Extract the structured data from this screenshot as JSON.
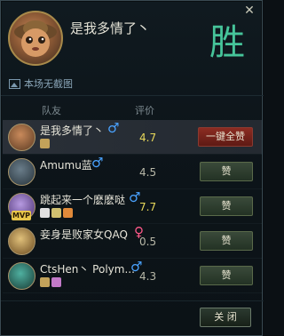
{
  "window": {
    "close_glyph": "✕"
  },
  "header": {
    "player_name": "是我多情了丶",
    "result": "胜",
    "screenshot_label": "本场无截图"
  },
  "columns": {
    "team": "队友",
    "rating": "评价"
  },
  "rows": [
    {
      "name": "是我多情了丶",
      "gender": "♂",
      "score": "4.7",
      "button": "一键全赞",
      "mvp": "",
      "self": true
    },
    {
      "name": "Amumu蓝",
      "gender": "♂",
      "score": "4.5",
      "button": "赞",
      "mvp": ""
    },
    {
      "name": "跳起来一个麽麽哒",
      "gender": "♂",
      "score": "7.7",
      "button": "赞",
      "mvp": "MVP"
    },
    {
      "name": "妾身是败家女QAQ",
      "gender": "♀",
      "score": "0.5",
      "button": "赞",
      "mvp": ""
    },
    {
      "name": "CtsHen丶 Polym...",
      "gender": "♂",
      "score": "4.3",
      "button": "赞",
      "mvp": ""
    }
  ],
  "footer": {
    "close_label": "关 闭"
  },
  "colors": {
    "win": "#46c49a",
    "male": "#4aa3ff",
    "female": "#ff5a8a",
    "score_high": "#e7d85a"
  }
}
